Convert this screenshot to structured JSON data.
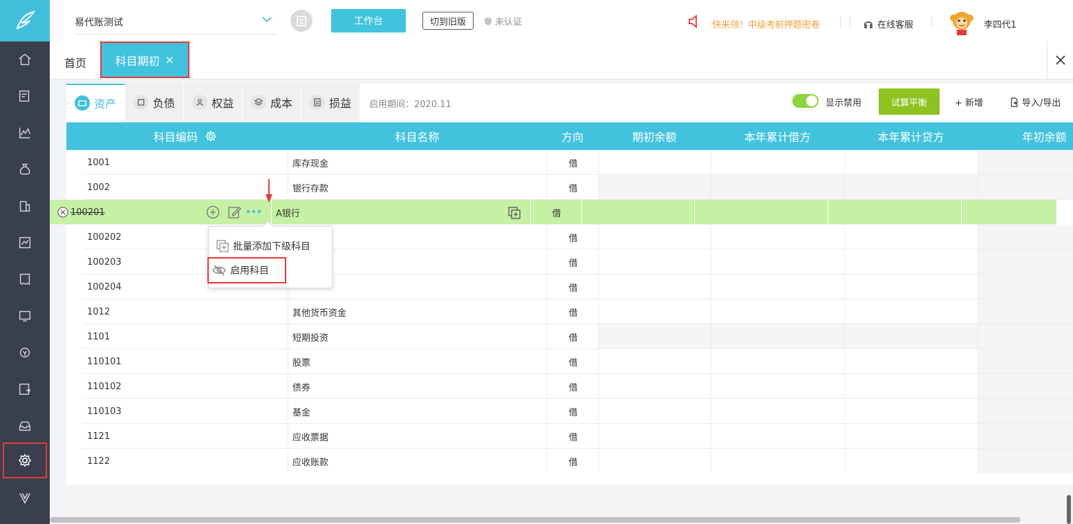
{
  "header": {
    "company": "易代账测试",
    "workbench": "工作台",
    "switch_old": "切到旧版",
    "unverified": "未认证",
    "promo": "快来领！中级考前押题密卷",
    "service": "在线客服",
    "username": "李四代1"
  },
  "tabs": {
    "home": "首页",
    "active": "科目期初",
    "close": "×"
  },
  "categories": [
    "资产",
    "负债",
    "权益",
    "成本",
    "损益"
  ],
  "period": "启用期间：2020.11",
  "toolbar": {
    "show_disabled": "显示禁用",
    "trial_balance": "试算平衡",
    "add": "+ 新增",
    "import_export": "导入/导出"
  },
  "columns": [
    "科目编码",
    "科目名称",
    "方向",
    "期初余额",
    "本年累计借方",
    "本年累计贷方",
    "年初余额"
  ],
  "rows": [
    {
      "code": "1001",
      "name": "库存现金",
      "dir": "借"
    },
    {
      "code": "1002",
      "name": "银行存款",
      "dir": "借"
    },
    {
      "code": "100201",
      "name": "A银行",
      "dir": "借"
    },
    {
      "code": "100202",
      "name": "",
      "dir": "借"
    },
    {
      "code": "100203",
      "name": "",
      "dir": "借"
    },
    {
      "code": "100204",
      "name": "",
      "dir": "借"
    },
    {
      "code": "1012",
      "name": "其他货币资金",
      "dir": "借"
    },
    {
      "code": "1101",
      "name": "短期投资",
      "dir": "借"
    },
    {
      "code": "110101",
      "name": "股票",
      "dir": "借"
    },
    {
      "code": "110102",
      "name": "债券",
      "dir": "借"
    },
    {
      "code": "110103",
      "name": "基金",
      "dir": "借"
    },
    {
      "code": "1121",
      "name": "应收票据",
      "dir": "借"
    },
    {
      "code": "1122",
      "name": "应收账款",
      "dir": "借"
    }
  ],
  "menu": {
    "batch_add": "批量添加下级科目",
    "enable": "启用科目"
  }
}
